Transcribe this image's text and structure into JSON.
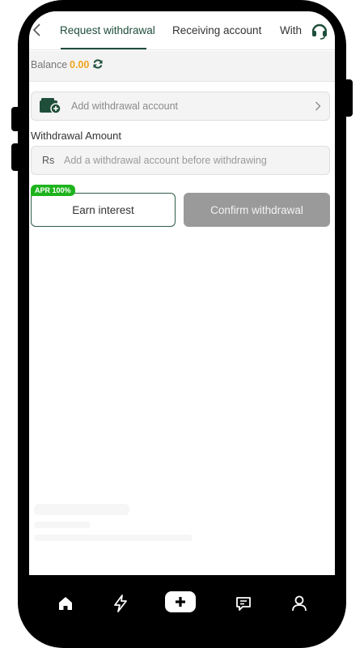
{
  "header": {
    "tabs": [
      {
        "label": "Request withdrawal",
        "active": true
      },
      {
        "label": "Receiving account",
        "active": false
      },
      {
        "label": "With",
        "active": false
      }
    ],
    "back_icon": "chevron-left-icon",
    "support_icon": "headset-icon"
  },
  "balance": {
    "label": "Balance",
    "value": "0.00",
    "refresh_icon": "refresh-icon"
  },
  "account": {
    "label": "Add withdrawal account",
    "icon": "wallet-add-icon"
  },
  "amount": {
    "title": "Withdrawal Amount",
    "currency": "Rs",
    "placeholder": "Add a withdrawal account before withdrawing",
    "value": ""
  },
  "actions": {
    "apr_badge": "APR 100%",
    "earn_label": "Earn interest",
    "confirm_label": "Confirm withdrawal"
  },
  "nav": {
    "items": [
      "home-icon",
      "bolt-icon",
      "plus-icon",
      "chat-icon",
      "user-icon"
    ]
  },
  "colors": {
    "accent": "#1f4e3a",
    "balance": "#f0a31c",
    "badge": "#1db31d",
    "disabled_button": "#9a9a9a"
  }
}
